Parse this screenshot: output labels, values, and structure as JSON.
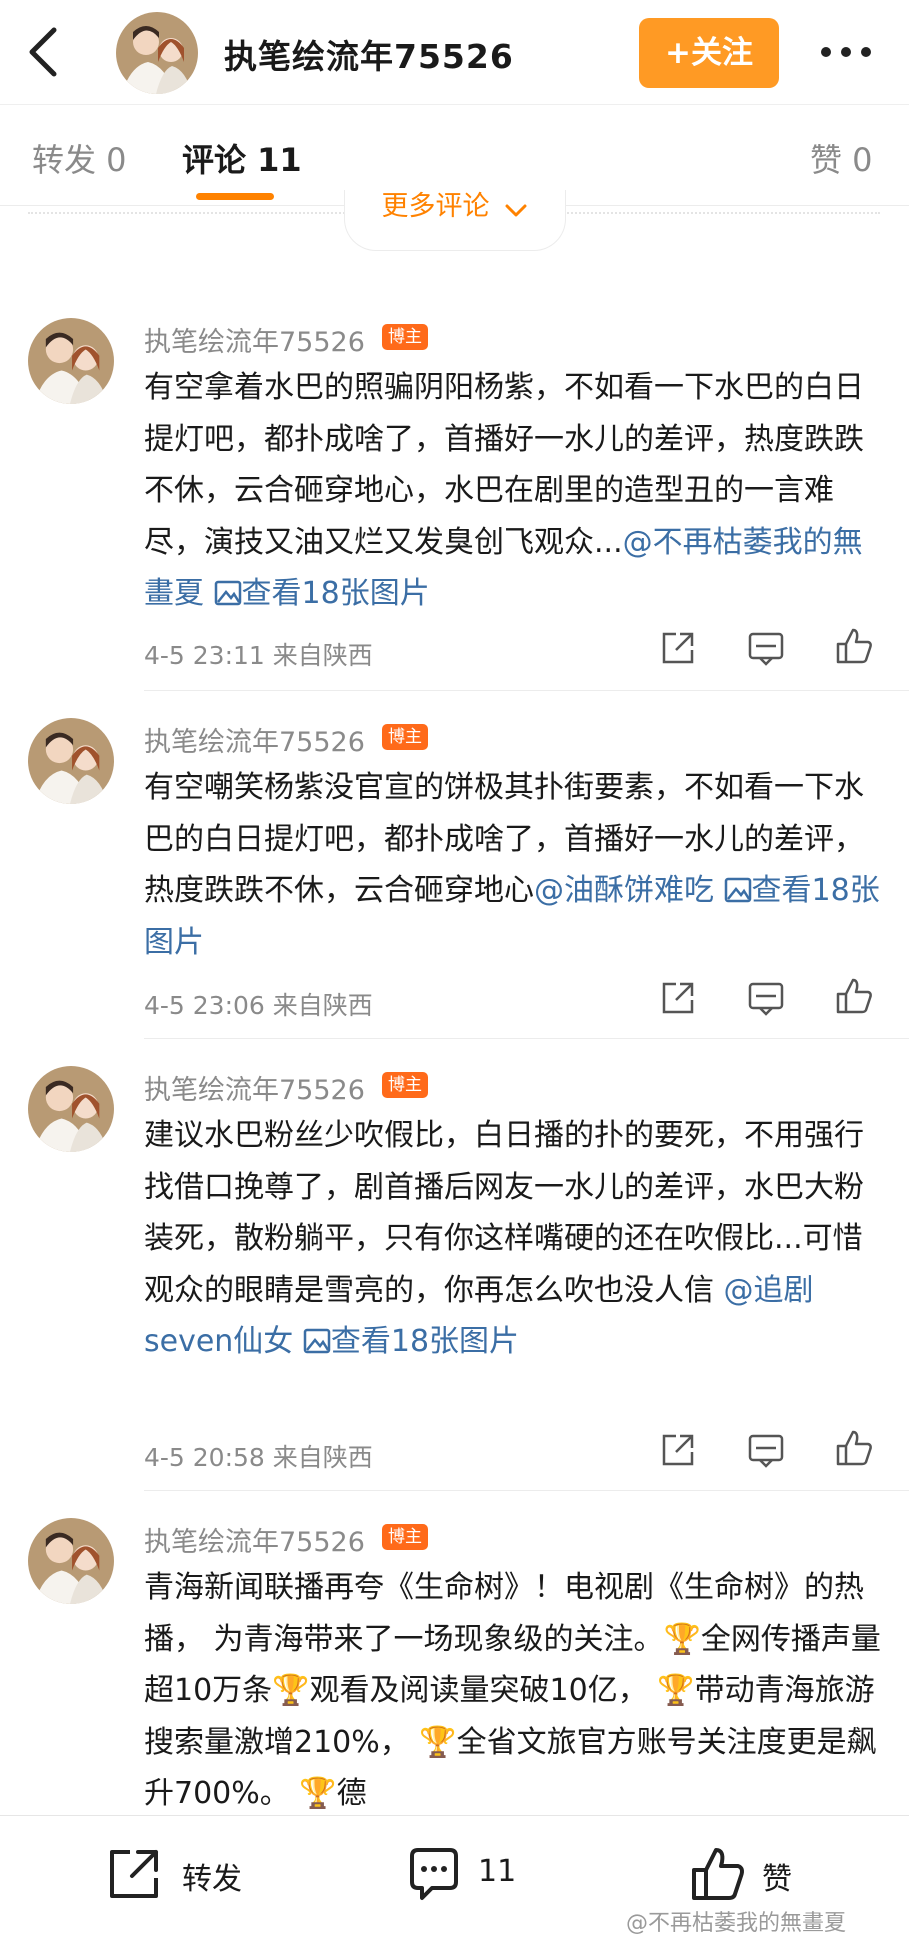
{
  "header": {
    "username": "执笔绘流年75526",
    "follow_label": "+关注"
  },
  "tabs": [
    {
      "label": "转发 0"
    },
    {
      "label": "评论 11"
    },
    {
      "label": "赞 0"
    }
  ],
  "more_comments_label": "更多评论",
  "comments": [
    {
      "author": "执笔绘流年75526",
      "badge": "博主",
      "text": "有空拿着水巴的照骗阴阳杨紫，不如看一下水巴的白日提灯吧，都扑成啥了，首播好一水儿的差评，热度跌跌不休，云合砸穿地心，水巴在剧里的造型丑的一言难尽，演技又油又烂又发臭创飞观众...",
      "mention": "@不再枯萎我的無畫夏",
      "pics": "查看18张图片",
      "time": "4-5 23:11",
      "source": "来自陕西"
    },
    {
      "author": "执笔绘流年75526",
      "badge": "博主",
      "text": "有空嘲笑杨紫没官宣的饼极其扑街要素，不如看一下水巴的白日提灯吧，都扑成啥了，首播好一水儿的差评，热度跌跌不休，云合砸穿地心",
      "mention": "@油酥饼难吃",
      "pics": "查看18张图片",
      "time": "4-5 23:06",
      "source": "来自陕西"
    },
    {
      "author": "执笔绘流年75526",
      "badge": "博主",
      "text": "建议水巴粉丝少吹假比，白日播的扑的要死，不用强行找借口挽尊了，剧首播后网友一水儿的差评，水巴大粉装死，散粉躺平，只有你这样嘴硬的还在吹假比...可惜观众的眼睛是雪亮的，你再怎么吹也没人信",
      "mention": "@追剧seven仙女",
      "pics": "查看18张图片",
      "time": "4-5 20:58",
      "source": "来自陕西"
    },
    {
      "author": "执笔绘流年75526",
      "badge": "博主",
      "text": "青海新闻联播再夸《生命树》！电视剧《生命树》的热播， 为青海带来了一场现象级的关注。🏆全网传播声量超10万条🏆观看及阅读量突破10亿， 🏆带动青海旅游搜索量激增210%， 🏆全省文旅官方账号关注度更是飙升700%。 🏆德"
    }
  ],
  "bottom_bar": {
    "repost_label": "转发",
    "comment_count": "11",
    "like_label": "赞"
  },
  "watermark": "@不再枯萎我的無畫夏",
  "colors": {
    "accent": "#ff8200",
    "follow_button": "#ff9a24",
    "badge": "#ff6a1a",
    "link": "#3b6ea5"
  }
}
